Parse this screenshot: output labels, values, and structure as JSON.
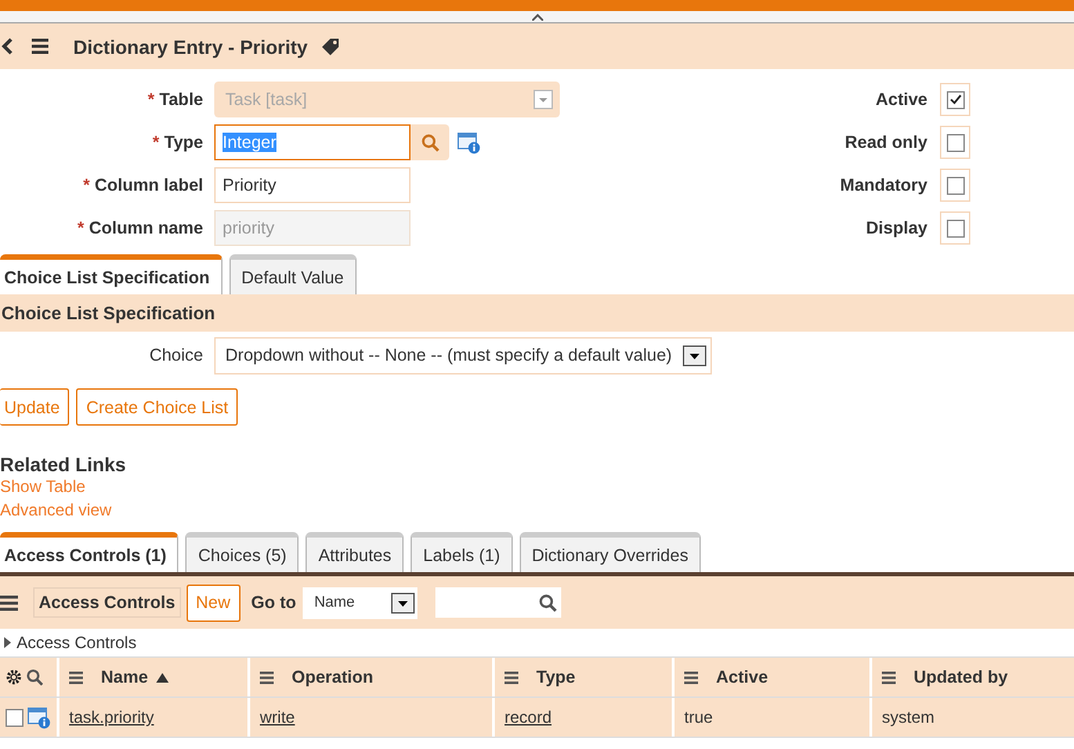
{
  "header": {
    "title": "Dictionary Entry - Priority"
  },
  "fields": [
    {
      "kind": "select",
      "required_mark": "*",
      "label": "Table",
      "value": "Task [task]",
      "disabled": true
    },
    {
      "kind": "reference",
      "required_mark": "*",
      "label": "Type",
      "value": "Integer",
      "text_selected": true
    },
    {
      "kind": "text",
      "required_mark": "*",
      "label": "Column label",
      "value": "Priority"
    },
    {
      "kind": "readonly",
      "required_mark": "*",
      "label": "Column name",
      "value": "priority"
    }
  ],
  "checkboxes": [
    {
      "label": "Active",
      "checked": true
    },
    {
      "label": "Read only",
      "checked": false
    },
    {
      "label": "Mandatory",
      "checked": false
    },
    {
      "label": "Display",
      "checked": false
    }
  ],
  "form_tabs": [
    {
      "label": "Choice List Specification",
      "selected": true
    },
    {
      "label": "Default Value",
      "selected": false
    }
  ],
  "section": {
    "title": "Choice List Specification",
    "choice_label": "Choice",
    "choice_value": "Dropdown without -- None -- (must specify a default value)"
  },
  "buttons": [
    "Update",
    "Create Choice List"
  ],
  "related_links": {
    "title": "Related Links",
    "links": [
      "Show Table",
      "Advanced view"
    ]
  },
  "list_tabs": [
    {
      "label": "Access Controls (1)",
      "selected": true
    },
    {
      "label": "Choices (5)",
      "selected": false
    },
    {
      "label": "Attributes",
      "selected": false
    },
    {
      "label": "Labels (1)",
      "selected": false
    },
    {
      "label": "Dictionary Overrides",
      "selected": false
    }
  ],
  "list": {
    "title": "Access Controls",
    "new_button": "New",
    "goto_label": "Go to",
    "goto_value": "Name",
    "breadcrumb": "Access Controls",
    "columns": [
      {
        "label": "Name",
        "sorted": true
      },
      {
        "label": "Operation",
        "sorted": false
      },
      {
        "label": "Type",
        "sorted": false
      },
      {
        "label": "Active",
        "sorted": false
      },
      {
        "label": "Updated by",
        "sorted": false
      }
    ],
    "rows": [
      {
        "checked": false,
        "cells": [
          {
            "text": "task.priority",
            "link": true
          },
          {
            "text": "write",
            "link": true
          },
          {
            "text": "record",
            "link": true
          },
          {
            "text": "true",
            "link": false
          },
          {
            "text": "system",
            "link": false
          }
        ]
      }
    ]
  }
}
